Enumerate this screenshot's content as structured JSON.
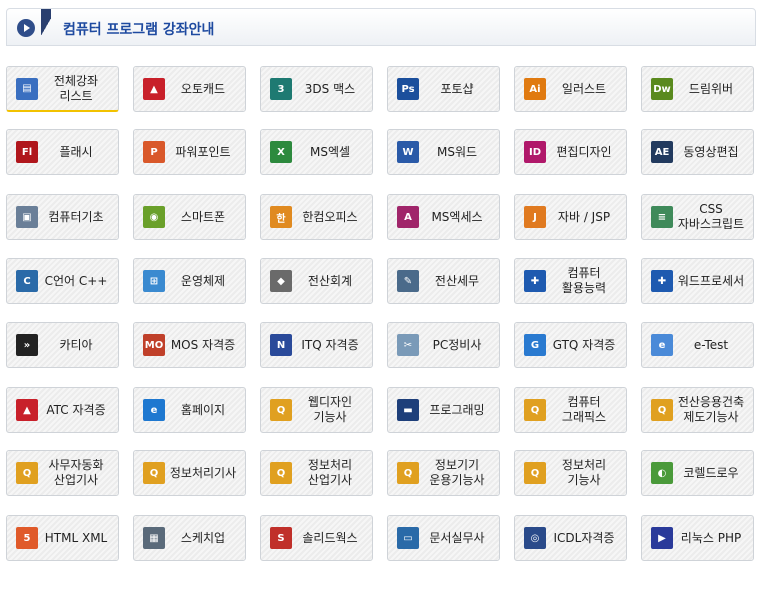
{
  "header": {
    "title": "컴퓨터 프로그램 강좌안내"
  },
  "rows": [
    [
      {
        "label": "전체강좌\n리스트",
        "icon": "list-book-icon",
        "color": "#3a6fc0",
        "glyph": "▤",
        "active": true
      },
      {
        "label": "오토캐드",
        "icon": "autocad-icon",
        "color": "#c8202a",
        "glyph": "▲"
      },
      {
        "label": "3DS 맥스",
        "icon": "3dsmax-icon",
        "color": "#1e7a72",
        "glyph": "3"
      },
      {
        "label": "포토샵",
        "icon": "photoshop-icon",
        "color": "#1b4f9c",
        "glyph": "Ps"
      },
      {
        "label": "일러스트",
        "icon": "illustrator-icon",
        "color": "#e07a10",
        "glyph": "Ai"
      },
      {
        "label": "드림위버",
        "icon": "dreamweaver-icon",
        "color": "#5a8a1e",
        "glyph": "Dw"
      }
    ],
    [
      {
        "label": "플래시",
        "icon": "flash-icon",
        "color": "#b0161c",
        "glyph": "Fl"
      },
      {
        "label": "파워포인트",
        "icon": "powerpoint-icon",
        "color": "#d9582a",
        "glyph": "P"
      },
      {
        "label": "MS엑셀",
        "icon": "excel-icon",
        "color": "#2d8a3e",
        "glyph": "X"
      },
      {
        "label": "MS워드",
        "icon": "word-icon",
        "color": "#2a5aa8",
        "glyph": "W"
      },
      {
        "label": "편집디자인",
        "icon": "indesign-icon",
        "color": "#b0186a",
        "glyph": "ID"
      },
      {
        "label": "동영상편집",
        "icon": "aftereffects-icon",
        "color": "#223a5e",
        "glyph": "AE"
      }
    ],
    [
      {
        "label": "컴퓨터기초",
        "icon": "computer-icon",
        "color": "#6a7f98",
        "glyph": "▣"
      },
      {
        "label": "스마트폰",
        "icon": "android-icon",
        "color": "#6aa02a",
        "glyph": "◉"
      },
      {
        "label": "한컴오피스",
        "icon": "hancom-office-icon",
        "color": "#e08a20",
        "glyph": "한"
      },
      {
        "label": "MS엑세스",
        "icon": "access-icon",
        "color": "#a0256a",
        "glyph": "A"
      },
      {
        "label": "자바 / JSP",
        "icon": "java-icon",
        "color": "#e07a20",
        "glyph": "J"
      },
      {
        "label": "CSS\n자바스크립트",
        "icon": "css-icon",
        "color": "#3f8a5a",
        "glyph": "≡"
      }
    ],
    [
      {
        "label": "C언어 C++",
        "icon": "c-language-icon",
        "color": "#2a6aa8",
        "glyph": "C"
      },
      {
        "label": "운영체제",
        "icon": "windows-icon",
        "color": "#3a8ad0",
        "glyph": "⊞"
      },
      {
        "label": "전산회계",
        "icon": "accounting-icon",
        "color": "#6a6a6a",
        "glyph": "◆"
      },
      {
        "label": "전산세무",
        "icon": "tax-icon",
        "color": "#4a6a8a",
        "glyph": "✎"
      },
      {
        "label": "컴퓨터\n활용능력",
        "icon": "puzzle-icon",
        "color": "#1e5ab0",
        "glyph": "✚"
      },
      {
        "label": "워드프로세서",
        "icon": "puzzle-icon",
        "color": "#1e5ab0",
        "glyph": "✚"
      }
    ],
    [
      {
        "label": "카티아",
        "icon": "catia-icon",
        "color": "#222222",
        "glyph": "»"
      },
      {
        "label": "MOS 자격증",
        "icon": "mos-icon",
        "color": "#c0402a",
        "glyph": "MO"
      },
      {
        "label": "ITQ 자격증",
        "icon": "itq-icon",
        "color": "#2a4a9a",
        "glyph": "N"
      },
      {
        "label": "PC정비사",
        "icon": "pc-repair-icon",
        "color": "#7a9ab8",
        "glyph": "✂"
      },
      {
        "label": "GTQ 자격증",
        "icon": "gtq-icon",
        "color": "#2a7ad0",
        "glyph": "G"
      },
      {
        "label": "e-Test",
        "icon": "etest-icon",
        "color": "#4a8ad8",
        "glyph": "e"
      }
    ],
    [
      {
        "label": "ATC 자격증",
        "icon": "autocad-icon",
        "color": "#c8202a",
        "glyph": "▲"
      },
      {
        "label": "홈페이지",
        "icon": "internet-explorer-icon",
        "color": "#1e78d0",
        "glyph": "e"
      },
      {
        "label": "웹디자인\n기능사",
        "icon": "qnet-icon",
        "color": "#e0a020",
        "glyph": "Q"
      },
      {
        "label": "프로그래밍",
        "icon": "monitor-icon",
        "color": "#1e3f7a",
        "glyph": "▬"
      },
      {
        "label": "컴퓨터\n그래픽스",
        "icon": "qnet-icon",
        "color": "#e0a020",
        "glyph": "Q"
      },
      {
        "label": "전산응용건축\n제도기능사",
        "icon": "qnet-icon",
        "color": "#e0a020",
        "glyph": "Q"
      }
    ],
    [
      {
        "label": "사무자동화\n산업기사",
        "icon": "qnet-icon",
        "color": "#e0a020",
        "glyph": "Q"
      },
      {
        "label": "정보처리기사",
        "icon": "qnet-icon",
        "color": "#e0a020",
        "glyph": "Q"
      },
      {
        "label": "정보처리\n산업기사",
        "icon": "qnet-icon",
        "color": "#e0a020",
        "glyph": "Q"
      },
      {
        "label": "정보기기\n운용기능사",
        "icon": "qnet-icon",
        "color": "#e0a020",
        "glyph": "Q"
      },
      {
        "label": "정보처리\n기능사",
        "icon": "qnet-icon",
        "color": "#e0a020",
        "glyph": "Q"
      },
      {
        "label": "코렐드로우",
        "icon": "coreldraw-icon",
        "color": "#4a9a3a",
        "glyph": "◐"
      }
    ],
    [
      {
        "label": "HTML XML",
        "icon": "html5-icon",
        "color": "#e05a2a",
        "glyph": "5"
      },
      {
        "label": "스케치업",
        "icon": "sketchup-icon",
        "color": "#5a6a7a",
        "glyph": "▦"
      },
      {
        "label": "솔리드웍스",
        "icon": "solidworks-icon",
        "color": "#c0302a",
        "glyph": "S"
      },
      {
        "label": "문서실무사",
        "icon": "document-icon",
        "color": "#2a6aa8",
        "glyph": "▭"
      },
      {
        "label": "ICDL자격증",
        "icon": "icdl-icon",
        "color": "#2a4a8a",
        "glyph": "◎"
      },
      {
        "label": "리눅스 PHP",
        "icon": "linux-icon",
        "color": "#2a3a9a",
        "glyph": "▶"
      }
    ]
  ]
}
